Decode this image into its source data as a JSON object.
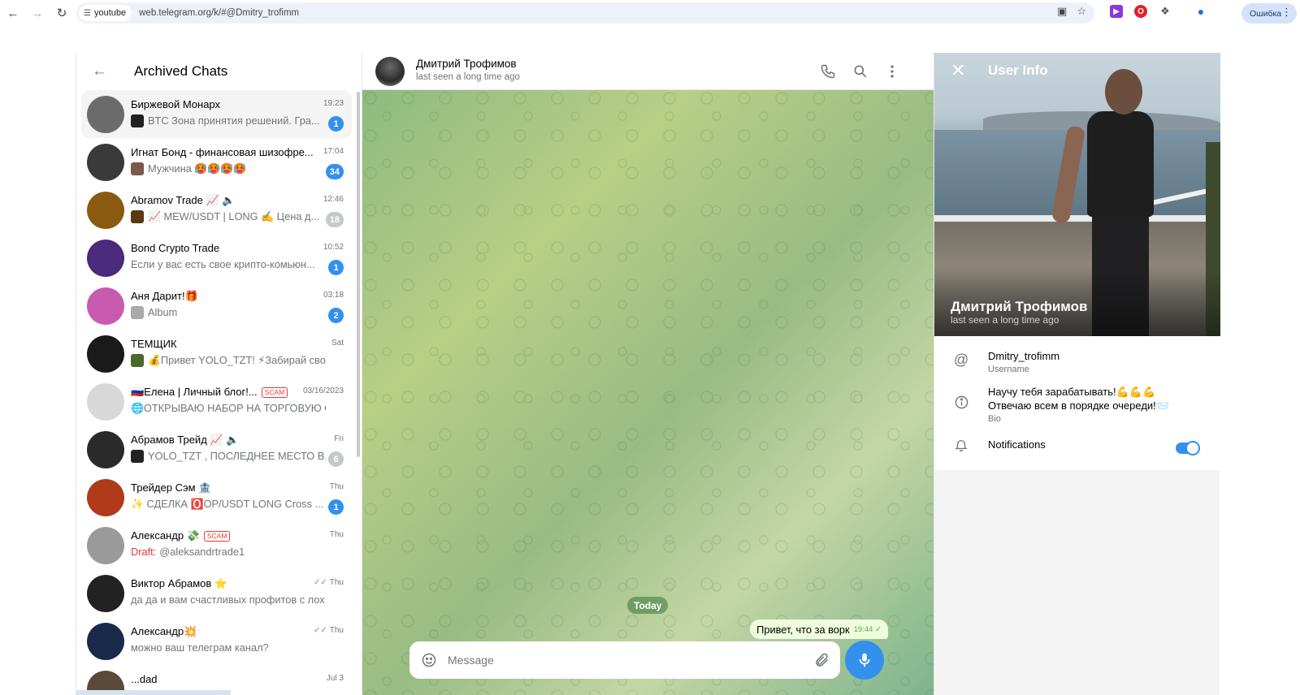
{
  "browser": {
    "site_chip": "youtube",
    "url": "web.telegram.org/k/#@Dmitry_trofimm",
    "profile_button": "Ошибка"
  },
  "archive": {
    "title": "Archived Chats",
    "chats": [
      {
        "name": "Биржевой Монарх",
        "time": "19:23",
        "preview": "BTC Зона принятия решений. Гра...",
        "badge": "1",
        "muted": false,
        "avatar_color": "#6b6b6b",
        "thumb_color": "#222"
      },
      {
        "name": "Игнат Бонд - финансовая шизофре...",
        "time": "17:04",
        "preview": "Мужчина 🥵🥵🥵🥵",
        "badge": "34",
        "muted": false,
        "avatar_color": "#3a3a3a",
        "thumb_color": "#7a5a4a"
      },
      {
        "name": "Abramov Trade 📈 🔈",
        "time": "12:46",
        "preview": "📈 MEW/USDT | LONG ✍️ Цена д...",
        "badge": "18",
        "muted": true,
        "avatar_color": "#8a5a10",
        "thumb_color": "#5a3a10"
      },
      {
        "name": "Bond Crypto Trade",
        "time": "10:52",
        "preview": "Если у вас есть свое крипто-комьюн...",
        "badge": "1",
        "muted": false,
        "avatar_color": "#4a2a7a",
        "thumb_color": ""
      },
      {
        "name": "Аня Дарит!🎁",
        "time": "03:18",
        "preview": "Album",
        "badge": "2",
        "muted": false,
        "avatar_color": "#c85ab0",
        "thumb_color": "#aaa"
      },
      {
        "name": "ТЕМЩИК",
        "time": "Sat",
        "preview": "💰Привет YOLO_TZT! ⚡Забирай свои...",
        "badge": "",
        "muted": false,
        "avatar_color": "#1a1a1a",
        "thumb_color": "#4a6a2a"
      },
      {
        "name": "🇷🇺Елена | Личный блог!...",
        "time": "03/16/2023",
        "preview": "🌐ОТКРЫВАЮ НАБОР НА ТОРГОВУЮ СЕ...",
        "badge": "",
        "muted": false,
        "scam": "SCAM",
        "avatar_color": "#d8d8d8",
        "thumb_color": ""
      },
      {
        "name": "Абрамов Трейд 📈 🔈",
        "time": "Fri",
        "preview": "YOLO_TZT , ПОСЛЕДНЕЕ МЕСТО В...",
        "badge": "6",
        "muted": true,
        "avatar_color": "#2a2a2a",
        "thumb_color": "#222"
      },
      {
        "name": "Трейдер Сэм 🏦",
        "time": "Thu",
        "preview": "✨ СДЕЛКА 🅾️OP/USDT LONG Cross ...",
        "badge": "1",
        "muted": false,
        "avatar_color": "#b03a1a",
        "thumb_color": ""
      },
      {
        "name": "Александр 💸",
        "time": "Thu",
        "preview": "@aleksandrtrade1",
        "draft": "Draft:",
        "badge": "",
        "muted": false,
        "scam": "SCAM",
        "avatar_color": "#9a9a9a",
        "thumb_color": ""
      },
      {
        "name": "Виктор Абрамов ⭐",
        "time": "Thu",
        "preview": "да да и вам счастливых профитов с лох...",
        "badge": "",
        "muted": false,
        "read": true,
        "avatar_color": "#222",
        "thumb_color": ""
      },
      {
        "name": "Александр💥",
        "time": "Thu",
        "preview": "можно ваш телеграм канал?",
        "badge": "",
        "muted": false,
        "read": true,
        "avatar_color": "#1a2a4a",
        "thumb_color": ""
      },
      {
        "name": "...dad",
        "time": "Jul 3",
        "preview": "",
        "badge": "",
        "muted": false,
        "avatar_color": "#5a4a3a",
        "thumb_color": ""
      }
    ]
  },
  "conversation": {
    "peer_name": "Дмитрий Трофимов",
    "peer_status": "last seen a long time ago",
    "date_pill": "Today",
    "message_text": "Привет, что за ворк",
    "message_time": "19:44",
    "composer_placeholder": "Message"
  },
  "user_info": {
    "title": "User Info",
    "name": "Дмитрий Трофимов",
    "status": "last seen a long time ago",
    "username": "Dmitry_trofimm",
    "username_label": "Username",
    "bio_line1": "Научу тебя зарабатывать!💪💪💪",
    "bio_line2": "Отвечаю всем в порядке очереди!📨",
    "bio_label": "Bio",
    "notifications_label": "Notifications",
    "notifications_on": true
  },
  "colors": {
    "accent": "#3390ec",
    "muted_badge": "#c4c9cc",
    "scam": "#e53935",
    "bubble_out": "#effdde"
  }
}
